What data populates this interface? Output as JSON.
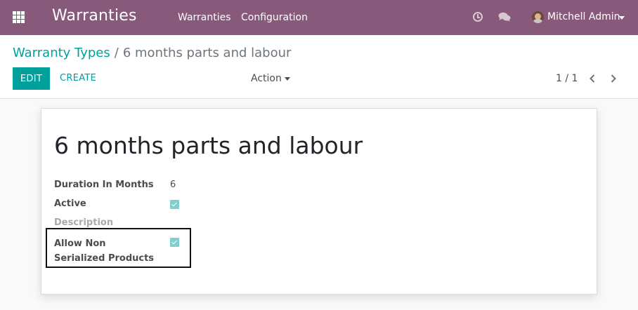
{
  "navbar": {
    "app_title": "Warranties",
    "menu": [
      "Warranties",
      "Configuration"
    ],
    "user_name": "Mitchell Admin",
    "accent_color": "#875a7b"
  },
  "control_panel": {
    "breadcrumb_parent": "Warranty Types",
    "breadcrumb_separator": "/",
    "breadcrumb_current": "6 months parts and labour",
    "edit_label": "EDIT",
    "create_label": "CREATE",
    "action_label": "Action",
    "pager": "1 / 1",
    "primary_color": "#00a09d"
  },
  "record": {
    "title": "6 months parts and labour",
    "fields": [
      {
        "label": "Duration In Months",
        "value": "6"
      },
      {
        "label": "Active",
        "checked": true
      },
      {
        "label": "Description",
        "value": ""
      },
      {
        "label": "Allow Non Serialized Products",
        "checked": true
      }
    ]
  },
  "icons": {
    "apps": "apps-grid-icon",
    "activity": "clock-icon",
    "messaging": "chat-icon",
    "pager_prev": "chevron-left-icon",
    "pager_next": "chevron-right-icon"
  }
}
